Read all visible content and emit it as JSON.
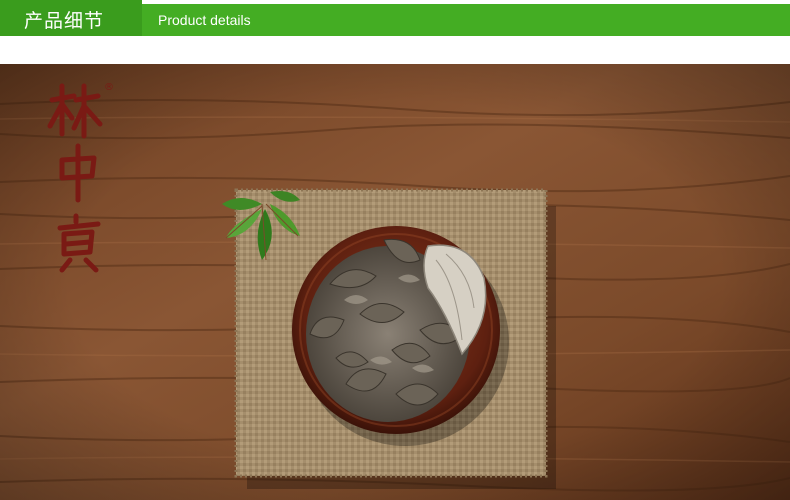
{
  "header": {
    "title_cn": "产品细节",
    "title_en": "Product details"
  },
  "photo": {
    "brand_logo_text": "林中寶",
    "registered_mark": "®"
  },
  "colors": {
    "header_tab": "#3a9c1d",
    "header_bar": "#44ad23",
    "logo_red": "#7a1a14",
    "wood": "#7a4a2c",
    "burlap": "#a08a6a"
  }
}
